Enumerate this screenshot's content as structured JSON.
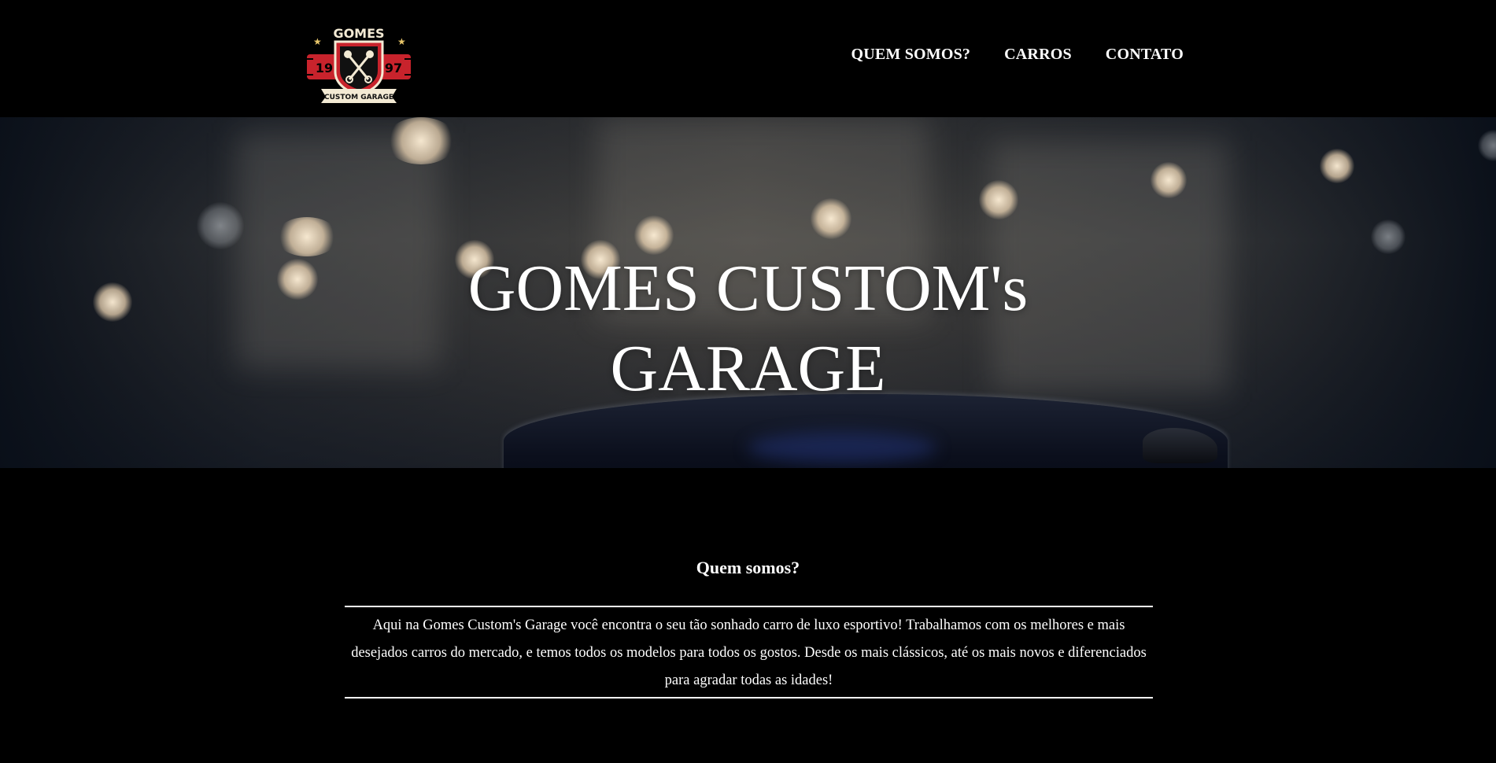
{
  "logo": {
    "top_text": "GOMES",
    "year_left": "19",
    "year_right": "97",
    "banner_text": "CUSTOM GARAGE"
  },
  "nav": {
    "items": [
      {
        "label": "QUEM SOMOS?"
      },
      {
        "label": "CARROS"
      },
      {
        "label": "CONTATO"
      }
    ]
  },
  "hero": {
    "title_line1": "GOMES CUSTOM's",
    "title_line2": "GARAGE"
  },
  "about": {
    "title": "Quem somos?",
    "text": "Aqui na Gomes Custom's Garage você encontra o seu tão sonhado carro de luxo esportivo! Trabalhamos com os melhores e mais desejados carros do mercado, e temos todos os modelos para todos os gostos. Desde os mais clássicos, até os mais novos e diferenciados para agradar todas as idades!"
  },
  "colors": {
    "background": "#000000",
    "text": "#ffffff",
    "logo_red": "#c8232c",
    "logo_cream": "#f3ead4"
  }
}
